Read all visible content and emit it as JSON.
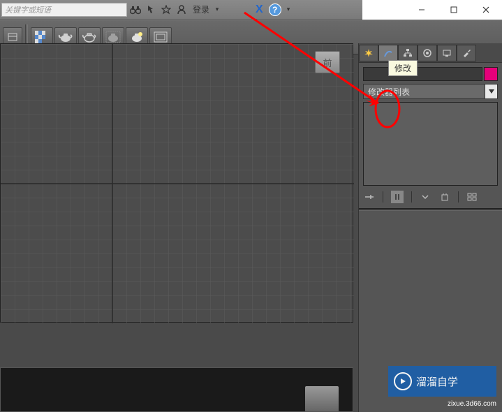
{
  "menubar": {
    "search_placeholder": "关键字或短语",
    "login_label": "登录"
  },
  "cmd_panel": {
    "tooltip": "修改",
    "modifier_list_label": "修改器列表"
  },
  "viewport": {
    "label": "前"
  },
  "watermark": {
    "text": "溜溜自学",
    "sub": "zixue.3d66.com"
  },
  "icons": {
    "binoculars": "binoculars",
    "pointer": "pointer",
    "star": "star",
    "person": "person",
    "dropdown": "▾",
    "x_logo": "X",
    "help": "?",
    "minimize": "—",
    "maximize": "☐",
    "close": "✕",
    "create": "✸",
    "modify": "modify",
    "hierarchy": "hierarchy",
    "motion": "◎",
    "display": "display",
    "utilities": "hammer",
    "pin": "pin",
    "configure": "II",
    "show_end": "show",
    "make_unique": "unique",
    "remove": "remove",
    "sets": "sets",
    "play": "▷"
  }
}
